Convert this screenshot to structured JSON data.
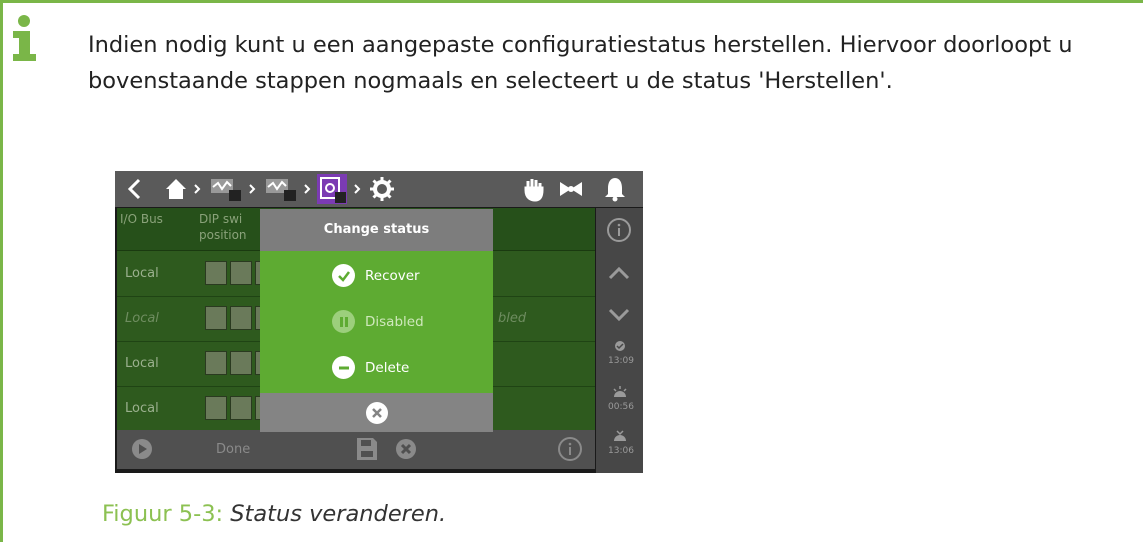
{
  "note": {
    "paragraph": "Indien nodig kunt u een aangepaste configuratiestatus herstellen. Hiervoor doorloopt u bovenstaande stappen nogmaals en selecteert u de status 'Herstellen'.",
    "accent_color": "#7ab648",
    "icon": "info-icon"
  },
  "screenshot": {
    "table": {
      "headers": [
        "I/O Bus",
        "DIP swi",
        "position"
      ],
      "rows": [
        {
          "location": "Local"
        },
        {
          "location": "Local",
          "status_fragment": "bled"
        },
        {
          "location": "Local"
        },
        {
          "location": "Local"
        }
      ]
    },
    "bottom_bar": {
      "done_label": "Done"
    },
    "sidebar": {
      "times": [
        "13:09",
        "00:56",
        "13:06"
      ]
    },
    "dialog": {
      "title": "Change status",
      "options": [
        {
          "label": "Recover",
          "icon": "check-icon"
        },
        {
          "label": "Disabled",
          "icon": "pause-icon"
        },
        {
          "label": "Delete",
          "icon": "minus-icon"
        }
      ]
    }
  },
  "caption": {
    "label": "Figuur 5-3: ",
    "text": "Status veranderen."
  }
}
